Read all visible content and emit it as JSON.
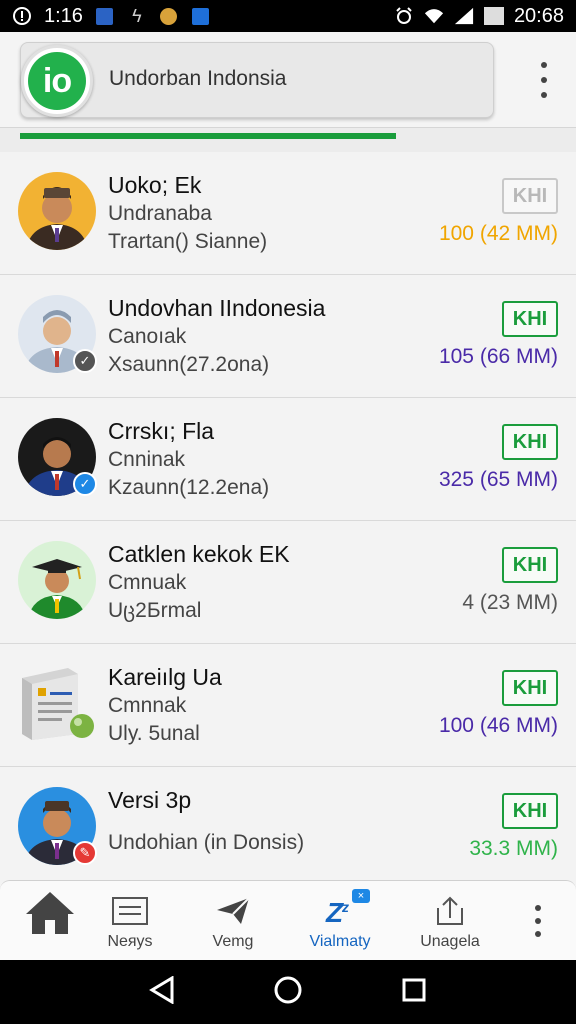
{
  "status_bar": {
    "time": "1:16",
    "clock": "20:68",
    "icons": [
      "notification-icon",
      "usb-icon",
      "app-icon",
      "download-icon",
      "alarm-icon",
      "wifi-icon",
      "signal-icon",
      "battery-icon"
    ]
  },
  "header": {
    "title": "Undorban Indonsia",
    "logo_text": "io",
    "brand_color": "#22b14c"
  },
  "list": [
    {
      "name": "Uoko; Ek",
      "subtitle": "Undranaba",
      "description": "Trartan() Sianne)",
      "button_label": "KHI",
      "size": "100 (42 MM)",
      "size_color": "#f0a500",
      "faded": true,
      "badge": ""
    },
    {
      "name": "Undovhan IIndonesia",
      "subtitle": "Canoıak",
      "description": "Xsaunn(27.2ona)",
      "button_label": "KHI",
      "size": "105 (66 MM)",
      "size_color": "#4a2aa8",
      "faded": false,
      "badge": "check-dark"
    },
    {
      "name": "Crrskı; Fla",
      "subtitle": "Cnninak",
      "description": "Kzaunn(12.2ena)",
      "button_label": "KHI",
      "size": "325 (65 MM)",
      "size_color": "#4a2aa8",
      "faded": false,
      "badge": "check-blue"
    },
    {
      "name": "Catklen kekok EK",
      "subtitle": "Cmnuak",
      "description": "Uც2Бrmal",
      "button_label": "KHI",
      "size": "4 (23 MM)",
      "size_color": "#555555",
      "faded": false,
      "badge": ""
    },
    {
      "name": "Kareiılg Ua",
      "subtitle": "Cmnnak",
      "description": "Uly. 5unal",
      "button_label": "KHI",
      "size": "100 (46 MM)",
      "size_color": "#4a2aa8",
      "faded": false,
      "badge": ""
    },
    {
      "name": "Versi 3p",
      "subtitle": "Undohian (in Donsis)",
      "description": "",
      "button_label": "KHI",
      "size": "33.3 MM)",
      "size_color": "#2fb34a",
      "faded": false,
      "badge": "check-red"
    }
  ],
  "bottom_nav": {
    "items": [
      {
        "label": "",
        "icon": "home-icon"
      },
      {
        "label": "Neяys",
        "icon": "news-icon"
      },
      {
        "label": "Vemg",
        "icon": "send-icon"
      },
      {
        "label": "Vialmaty",
        "icon": "sleep-icon",
        "active": true,
        "badge": "×"
      },
      {
        "label": "Unagela",
        "icon": "upload-icon"
      }
    ]
  }
}
